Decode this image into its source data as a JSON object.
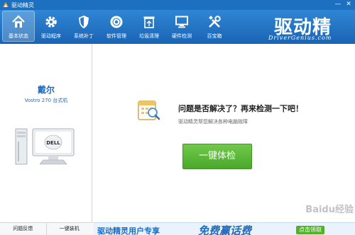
{
  "window": {
    "title": "驱动精灵",
    "controls": [
      "minimize-icon",
      "close-icon"
    ]
  },
  "toolbar": {
    "items": [
      {
        "label": "基本状态",
        "icon": "home-icon",
        "active": true
      },
      {
        "label": "驱动程序",
        "icon": "gear-icon",
        "active": false
      },
      {
        "label": "系统补丁",
        "icon": "shield-icon",
        "active": false
      },
      {
        "label": "软件管理",
        "icon": "disc-icon",
        "active": false
      },
      {
        "label": "垃圾清理",
        "icon": "trash-icon",
        "active": false
      },
      {
        "label": "硬件检测",
        "icon": "monitor-icon",
        "active": false
      },
      {
        "label": "百宝箱",
        "icon": "tools-icon",
        "active": false
      }
    ],
    "brand_cn": "驱动精灵",
    "brand_en": "DriverGenius.com"
  },
  "device": {
    "name": "戴尔",
    "model": "Vostro 270 台式机",
    "monitor_logo": "DELL"
  },
  "leftbar": {
    "feedback": "问题反馈",
    "install": "一键装机"
  },
  "main": {
    "question": "问题是否解决了？再来检测一下吧！",
    "subtitle": "驱动精灵帮您解决各种电脑故障",
    "check_button": "一键体检"
  },
  "banner": {
    "part1": "驱动精灵用户专享",
    "part2": "免费赢话费",
    "cta": "点击领取"
  },
  "watermark": "Baidu经验",
  "colors": {
    "toolbar": "#1d6fbf",
    "accent_blue": "#1f6cc0",
    "button_green": "#4aa82a"
  }
}
